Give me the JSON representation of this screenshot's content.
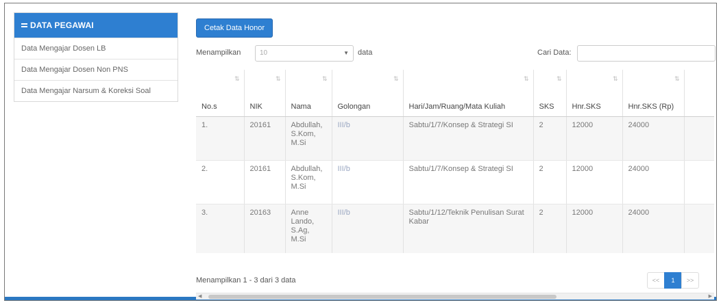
{
  "sidebar": {
    "title": "DATA PEGAWAI",
    "items": [
      {
        "label": "Data Mengajar Dosen LB"
      },
      {
        "label": "Data Mengajar Dosen Non PNS"
      },
      {
        "label": "Data Mengajar Narsum & Koreksi Soal"
      }
    ]
  },
  "main": {
    "print_button": "Cetak Data Honor",
    "show_label": "Menampilkan",
    "length_placeholder": "10",
    "data_label": "data",
    "search_label": "Cari Data:",
    "columns": [
      "No.s",
      "NIK",
      "Nama",
      "Golongan",
      "Hari/Jam/Ruang/Mata Kuliah",
      "SKS",
      "Hnr.SKS",
      "Hnr.SKS (Rp)",
      ""
    ],
    "rows": [
      {
        "no": "1.",
        "nik": "20161",
        "nama": "Abdullah, S.Kom, M.Si",
        "gol": "III/b",
        "kuliah": "Sabtu/1/7/Konsep & Strategi SI",
        "sks": "2",
        "hnr": "12000",
        "hnr_rp": "24000",
        "extra": ""
      },
      {
        "no": "2.",
        "nik": "20161",
        "nama": "Abdullah, S.Kom, M.Si",
        "gol": "III/b",
        "kuliah": "Sabtu/1/7/Konsep & Strategi SI",
        "sks": "2",
        "hnr": "12000",
        "hnr_rp": "24000",
        "extra": ""
      },
      {
        "no": "3.",
        "nik": "20163",
        "nama": "Anne Lando, S.Ag, M.Si",
        "gol": "III/b",
        "kuliah": "Sabtu/1/12/Teknik Penulisan Surat Kabar",
        "sks": "2",
        "hnr": "12000",
        "hnr_rp": "24000",
        "extra": ""
      }
    ],
    "info": "Menampilkan 1 - 3 dari 3 data",
    "pager": {
      "prev": "<<",
      "current": "1",
      "next": ">>"
    }
  },
  "colors": {
    "accent": "#2e7fd1"
  }
}
